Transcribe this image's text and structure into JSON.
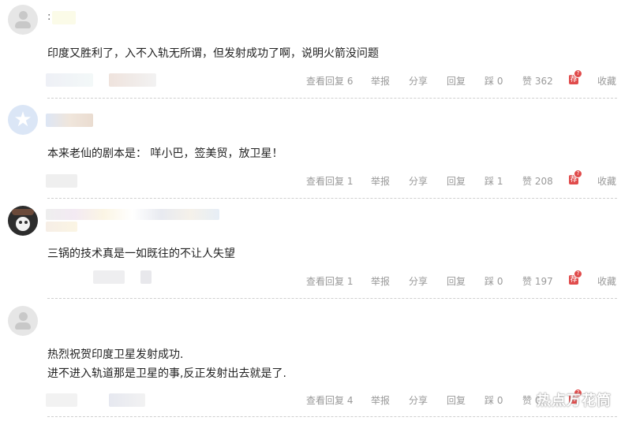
{
  "comments": [
    {
      "text": "印度又胜利了，入不入轨无所谓，但发射成功了啊，说明火箭没问题",
      "name_mark": ":",
      "actions": {
        "view_replies": "查看回复 6",
        "report": "举报",
        "share": "分享",
        "reply": "回复",
        "dislike": "踩 0",
        "like": "赞 362",
        "recommend": "荐",
        "recommend_badge": "?",
        "collect": "收藏"
      }
    },
    {
      "text": "本来老仙的剧本是： 咩小巴，签美贸，放卫星！",
      "actions": {
        "view_replies": "查看回复 1",
        "report": "举报",
        "share": "分享",
        "reply": "回复",
        "dislike": "踩 1",
        "like": "赞 208",
        "recommend": "荐",
        "recommend_badge": "?",
        "collect": "收藏"
      }
    },
    {
      "text": "三锅的技术真是一如既往的不让人失望",
      "actions": {
        "view_replies": "查看回复 1",
        "report": "举报",
        "share": "分享",
        "reply": "回复",
        "dislike": "踩 0",
        "like": "赞 197",
        "recommend": "荐",
        "recommend_badge": "?",
        "collect": "收藏"
      }
    },
    {
      "text_line1": "热烈祝贺印度卫星发射成功.",
      "text_line2": "进不进入轨道那是卫星的事,反正发射出去就是了.",
      "actions": {
        "view_replies": "查看回复 4",
        "report": "举报",
        "share": "分享",
        "reply": "回复",
        "dislike": "踩 0",
        "like": "赞 0",
        "recommend": "荐",
        "recommend_badge": "?",
        "collect": "收藏"
      }
    }
  ],
  "watermark": "热点万花筒",
  "colors": {
    "action_text": "#999999",
    "recommend_red": "#e04b4b",
    "divider": "#cfcfcf"
  }
}
